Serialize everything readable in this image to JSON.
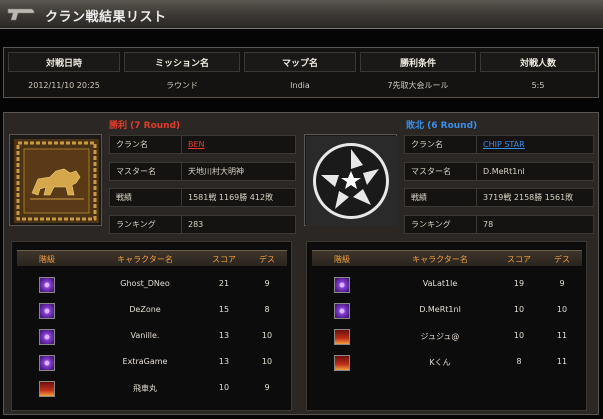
{
  "header": {
    "title": "クラン戦結果リスト"
  },
  "info": {
    "headers": [
      "対戦日時",
      "ミッション名",
      "マップ名",
      "勝利条件",
      "対戦人数"
    ],
    "values": [
      "2012/11/10 20:25",
      "ラウンド",
      "India",
      "7先取大会ルール",
      "5:5"
    ]
  },
  "labels": {
    "clan": "クラン名",
    "master": "マスター名",
    "record": "戦績",
    "ranking": "ランキング"
  },
  "roster_headers": {
    "rank": "階級",
    "character": "キャラクター名",
    "score": "スコア",
    "deaths": "デス"
  },
  "winner": {
    "title": "勝利 (7 Round)",
    "clan": "BEN",
    "master": "天地川村大明神",
    "record": "1581戦 1169勝 412敗",
    "ranking": "283",
    "players": [
      {
        "name": "Ghost_DNeo",
        "score": "21",
        "deaths": "9",
        "rank": "purple"
      },
      {
        "name": "DeZone",
        "score": "15",
        "deaths": "8",
        "rank": "purple"
      },
      {
        "name": "Vanille.",
        "score": "13",
        "deaths": "10",
        "rank": "purple"
      },
      {
        "name": "ExtraGame",
        "score": "13",
        "deaths": "10",
        "rank": "purple"
      },
      {
        "name": "飛車丸",
        "score": "10",
        "deaths": "9",
        "rank": "red"
      }
    ]
  },
  "loser": {
    "title": "敗北 (6 Round)",
    "clan": "CHIP STAR",
    "master": "D.MeRt1nl",
    "record": "3719戦 2158勝 1561敗",
    "ranking": "78",
    "players": [
      {
        "name": "VaLat1le",
        "score": "19",
        "deaths": "9",
        "rank": "purple"
      },
      {
        "name": "D.MeRt1nl",
        "score": "10",
        "deaths": "10",
        "rank": "purple"
      },
      {
        "name": "ジュジュ@",
        "score": "10",
        "deaths": "11",
        "rank": "red"
      },
      {
        "name": "Kくん",
        "score": "8",
        "deaths": "11",
        "rank": "red"
      }
    ]
  },
  "colors": {
    "win": "#e03c2c",
    "lose": "#3a8ee8",
    "accent": "#f0a040",
    "clan_link_win": "#e03c2c",
    "clan_link_lose": "#3a8ee8"
  }
}
